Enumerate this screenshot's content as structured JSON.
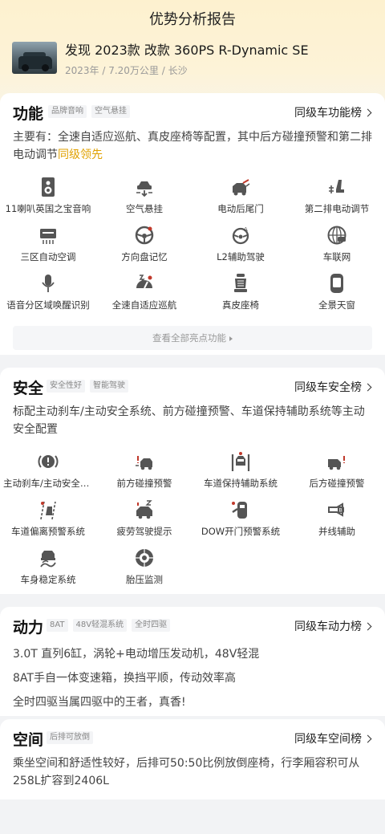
{
  "page_title": "优势分析报告",
  "car": {
    "title": "发现 2023款 改款 360PS R-Dynamic SE",
    "meta": "2023年 / 7.20万公里 / 长沙"
  },
  "function_section": {
    "title": "功能",
    "tags": [
      "品牌音响",
      "空气悬挂"
    ],
    "rank_link": "同级车功能榜",
    "desc_main": "主要有：全速自适应巡航、真皮座椅等配置，其中后方碰撞预警和第二排电动调节",
    "desc_highlight": "同级领先",
    "features": [
      {
        "label": "11喇叭英国之宝音响",
        "icon": "speaker-icon"
      },
      {
        "label": "空气悬挂",
        "icon": "air-suspension-icon"
      },
      {
        "label": "电动后尾门",
        "icon": "power-tailgate-icon"
      },
      {
        "label": "第二排电动调节",
        "icon": "power-seat-icon"
      },
      {
        "label": "三区自动空调",
        "icon": "climate-control-icon"
      },
      {
        "label": "方向盘记忆",
        "icon": "steering-wheel-icon"
      },
      {
        "label": "L2辅助驾驶",
        "icon": "assisted-driving-icon"
      },
      {
        "label": "车联网",
        "icon": "connected-car-icon"
      },
      {
        "label": "语音分区域唤醒识别",
        "icon": "microphone-icon"
      },
      {
        "label": "全速自适应巡航",
        "icon": "cruise-control-icon"
      },
      {
        "label": "真皮座椅",
        "icon": "leather-seat-icon"
      },
      {
        "label": "全景天窗",
        "icon": "panoramic-sunroof-icon"
      }
    ],
    "see_all": "查看全部亮点功能"
  },
  "safety_section": {
    "title": "安全",
    "tags": [
      "安全性好",
      "智能驾驶"
    ],
    "rank_link": "同级车安全榜",
    "desc": "标配主动刹车/主动安全系统、前方碰撞预警、车道保持辅助系统等主动安全配置",
    "features": [
      {
        "label": "主动刹车/主动安全系统",
        "icon": "active-brake-icon"
      },
      {
        "label": "前方碰撞预警",
        "icon": "front-collision-icon"
      },
      {
        "label": "车道保持辅助系统",
        "icon": "lane-keep-icon"
      },
      {
        "label": "后方碰撞预警",
        "icon": "rear-collision-icon"
      },
      {
        "label": "车道偏离预警系统",
        "icon": "lane-departure-icon"
      },
      {
        "label": "疲劳驾驶提示",
        "icon": "fatigue-alert-icon"
      },
      {
        "label": "DOW开门预警系统",
        "icon": "door-open-warning-icon"
      },
      {
        "label": "并线辅助",
        "icon": "blind-spot-icon"
      },
      {
        "label": "车身稳定系统",
        "icon": "stability-control-icon"
      },
      {
        "label": "胎压监测",
        "icon": "tire-pressure-icon"
      }
    ]
  },
  "power_section": {
    "title": "动力",
    "tags": [
      "8AT",
      "48V轻混系统",
      "全时四驱"
    ],
    "rank_link": "同级车动力榜",
    "lines": [
      "3.0T 直列6缸，涡轮+电动增压发动机，48V轻混",
      "8AT手自一体变速箱，换挡平顺，传动效率高",
      "全时四驱当属四驱中的王者，真香!"
    ]
  },
  "space_section": {
    "title": "空间",
    "tags": [
      "后排可放倒"
    ],
    "rank_link": "同级车空间榜",
    "desc": "乘坐空间和舒适性较好，后排可50:50比例放倒座椅，行李厢容积可从258L扩容到2406L"
  }
}
